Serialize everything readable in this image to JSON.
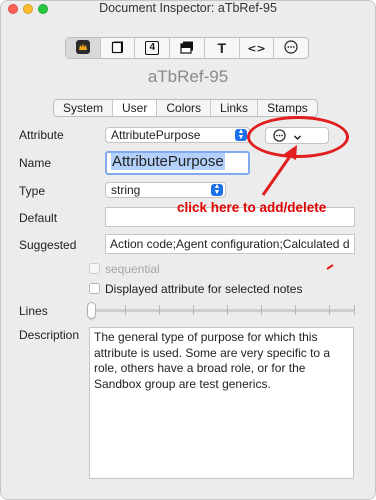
{
  "window": {
    "title": "Document Inspector: aTbRef-95",
    "doc_name": "aTbRef-95"
  },
  "toolbar": {
    "buttons": [
      {
        "icon": "document-app-icon",
        "label": ""
      },
      {
        "icon": "note-icon",
        "label": ""
      },
      {
        "icon": "stamp-4-icon",
        "label": "4"
      },
      {
        "icon": "stack-icon",
        "label": ""
      },
      {
        "icon": "text-icon",
        "label": "T"
      },
      {
        "icon": "code-icon",
        "label": "<>"
      },
      {
        "icon": "ellipsis-circle-icon",
        "label": ""
      }
    ]
  },
  "tabs": {
    "items": [
      "System",
      "User",
      "Colors",
      "Links",
      "Stamps"
    ],
    "active": "User"
  },
  "form": {
    "attribute_label": "Attribute",
    "attribute_value": "AttributePurpose",
    "name_label": "Name",
    "name_value": "AttributePurpose",
    "type_label": "Type",
    "type_value": "string",
    "default_label": "Default",
    "default_value": "",
    "suggested_label": "Suggested",
    "suggested_value": "Action code;Agent configuration;Calculated d",
    "sequential_label": "sequential",
    "displayed_label": "Displayed attribute for selected notes",
    "lines_label": "Lines",
    "lines_value_fraction": 0,
    "description_label": "Description",
    "description_value": "The general type of purpose for which this attribute is used. Some are very specific to a role, others have a broad role, or for the Sandbox group are test generics."
  },
  "annotation": {
    "text": "click here to add/delete",
    "color": "#e00000"
  },
  "colors": {
    "accent": "#1d71e8",
    "annotation_red": "#e11d1d"
  }
}
